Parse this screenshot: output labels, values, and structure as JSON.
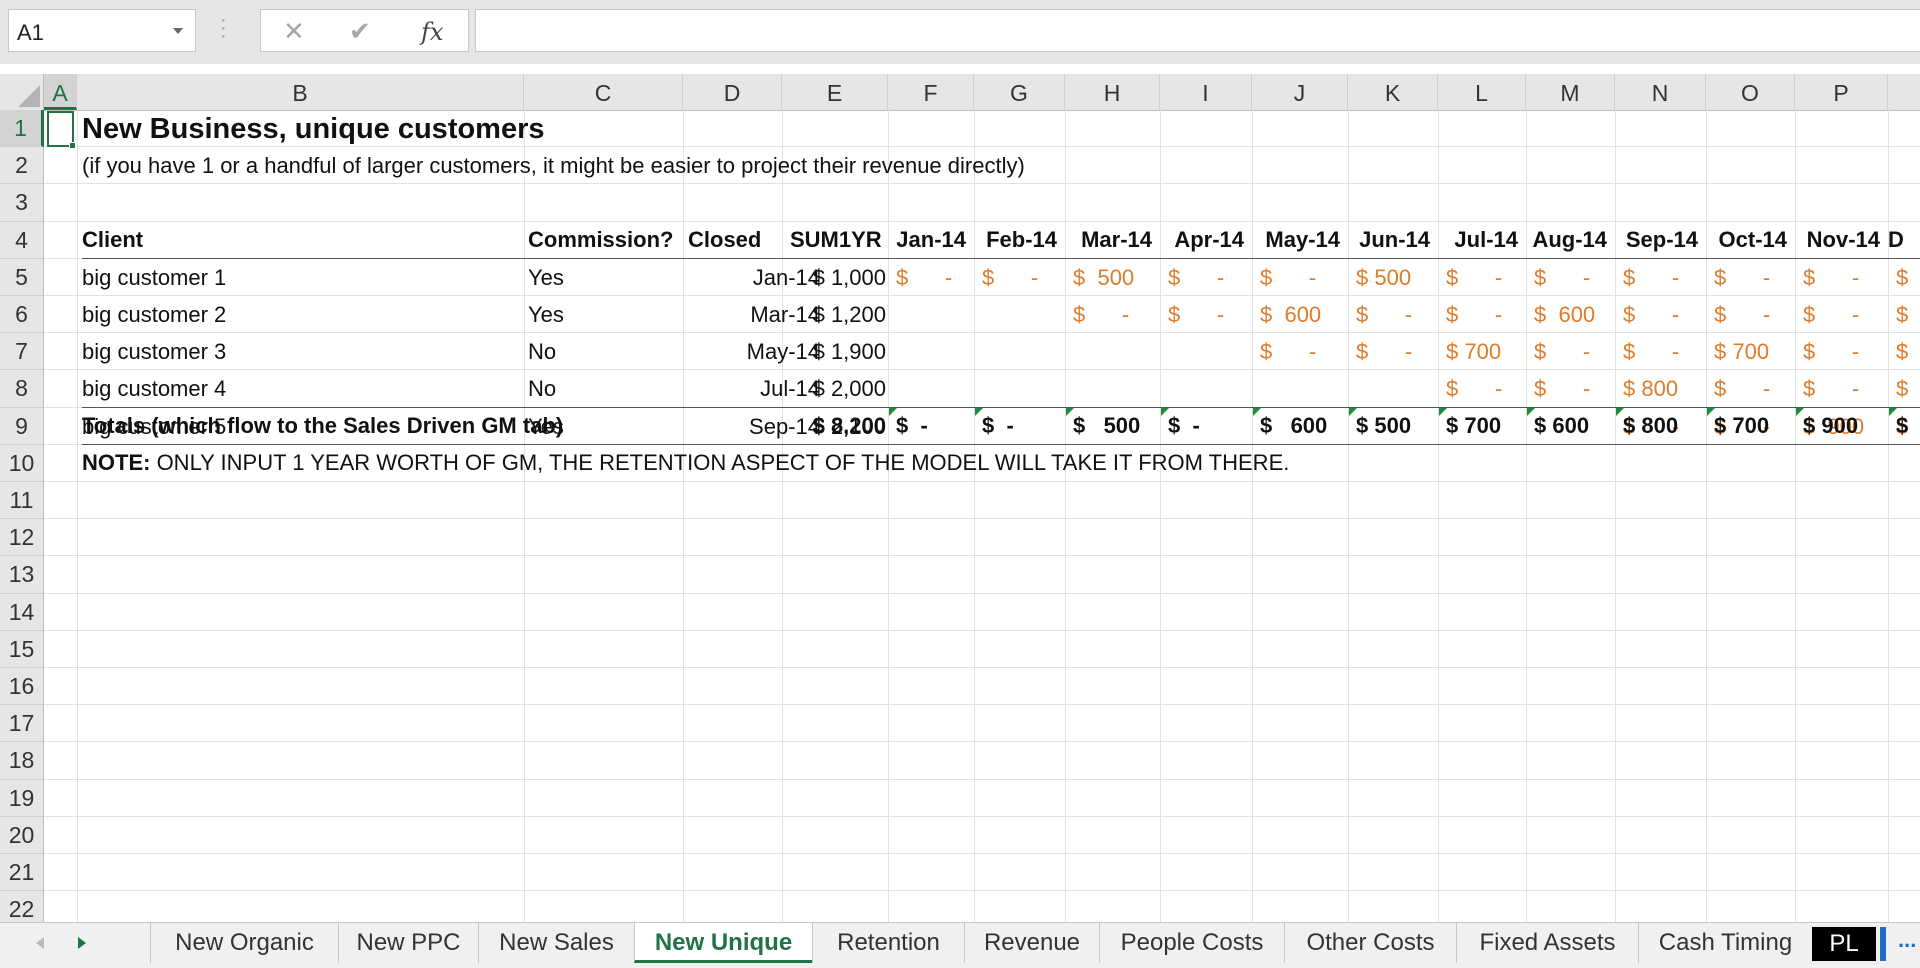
{
  "formula_bar": {
    "name_box": "A1",
    "cancel_icon": "✕",
    "enter_icon": "✔",
    "fx_label": "fx",
    "formula": ""
  },
  "columns": [
    "A",
    "B",
    "C",
    "D",
    "E",
    "F",
    "G",
    "H",
    "I",
    "J",
    "K",
    "L",
    "M",
    "N",
    "O",
    "P"
  ],
  "rows": [
    "1",
    "2",
    "3",
    "4",
    "5",
    "6",
    "7",
    "8",
    "9",
    "10",
    "11",
    "12",
    "13",
    "14",
    "15",
    "16",
    "17",
    "18",
    "19",
    "20",
    "21",
    "22"
  ],
  "sheet": {
    "title": "New Business, unique customers",
    "subtitle": "(if you have 1 or a handful of larger customers, it might be easier to project their revenue directly)",
    "headers": {
      "client": "Client",
      "commission": "Commission?",
      "closed": "Closed",
      "sum1yr": "SUM1YR",
      "months": [
        "Jan-14",
        "Feb-14",
        "Mar-14",
        "Apr-14",
        "May-14",
        "Jun-14",
        "Jul-14",
        "Aug-14",
        "Sep-14",
        "Oct-14",
        "Nov-14",
        "D"
      ]
    },
    "customers": [
      {
        "client": "big customer 1",
        "commission": "Yes",
        "closed": "Jan-14",
        "sum": "$  1,000",
        "months": [
          "$      -",
          "$      -",
          "$  500",
          "$      -",
          "$      -",
          "$ 500",
          "$      -",
          "$      -",
          "$      -",
          "$      -",
          "$      -",
          "$"
        ]
      },
      {
        "client": "big customer 2",
        "commission": "Yes",
        "closed": "Mar-14",
        "sum": "$  1,200",
        "months": [
          "",
          "",
          "$      -",
          "$      -",
          "$  600",
          "$      -",
          "$      -",
          "$  600",
          "$      -",
          "$      -",
          "$      -",
          "$"
        ]
      },
      {
        "client": "big customer 3",
        "commission": "No",
        "closed": "May-14",
        "sum": "$  1,900",
        "months": [
          "",
          "",
          "",
          "",
          "$      -",
          "$      -",
          "$ 700",
          "$      -",
          "$      -",
          "$ 700",
          "$      -",
          "$"
        ]
      },
      {
        "client": "big customer 4",
        "commission": "No",
        "closed": "Jul-14",
        "sum": "$  2,000",
        "months": [
          "",
          "",
          "",
          "",
          "",
          "",
          "$      -",
          "$      -",
          "$ 800",
          "$      -",
          "$      -",
          "$"
        ]
      },
      {
        "client": "big customer 5",
        "commission": "Yes",
        "closed": "Sep-14",
        "sum": "$  2,100",
        "months": [
          "",
          "",
          "",
          "",
          "",
          "",
          "",
          "",
          "$      -",
          "$      -",
          "$  900",
          "$"
        ]
      }
    ],
    "totals": {
      "label": "Totals (which flow to the Sales Driven GM tab)",
      "sum": "$  8,200",
      "months": [
        "$  -",
        "$  -",
        "$   500",
        "$  -",
        "$   600",
        "$ 500",
        "$ 700",
        "$ 600",
        "$ 800",
        "$ 700",
        "$ 900",
        "$"
      ]
    },
    "note_label": "NOTE:",
    "note_text": " ONLY INPUT 1 YEAR WORTH OF GM, THE RETENTION ASPECT OF THE MODEL WILL TAKE IT FROM THERE."
  },
  "tabs": [
    "New Organic",
    "New PPC",
    "New Sales",
    "New Unique",
    "Retention",
    "Revenue",
    "People Costs",
    "Other Costs",
    "Fixed Assets",
    "Cash Timing",
    "PL"
  ],
  "active_tab": "New Unique",
  "more_tabs": "...",
  "colors": {
    "accent": "#217346",
    "currency_orange": "#e07b29"
  }
}
